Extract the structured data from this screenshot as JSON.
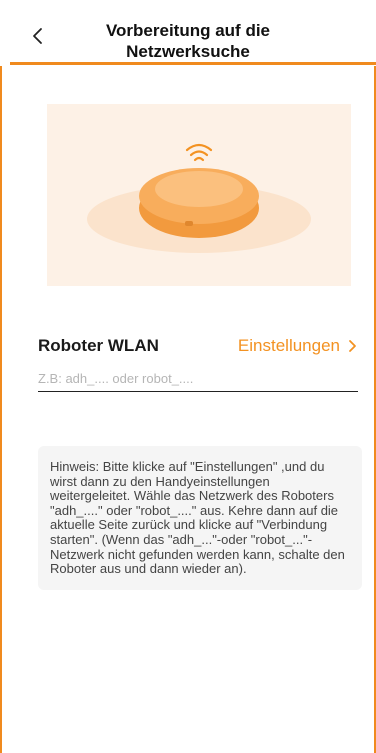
{
  "header": {
    "title_line1": "Vorbereitung auf die",
    "title_line2": "Netzwerksuche",
    "back_icon": "chevron-left-icon"
  },
  "illustration": {
    "description": "robot-vacuum-with-wifi",
    "colors": {
      "background": "#fdf1e6",
      "robot": "#f6a24a",
      "wifi": "#f39222"
    }
  },
  "wifi_section": {
    "label": "Roboter WLAN",
    "settings_link": "Einstellungen",
    "settings_icon": "chevron-right-icon",
    "input_placeholder": "Z.B: adh_.... oder robot_....",
    "input_value": ""
  },
  "hint": {
    "text": "Hinweis: Bitte klicke auf \"Einstellungen\" ,und du wirst dann zu den Handyeinstellungen weitergeleitet. Wähle das Netzwerk des Roboters \"adh_....\" oder \"robot_....\" aus. Kehre dann auf die aktuelle Seite zurück und klicke auf \"Verbindung starten\". (Wenn das \"adh_...\"-oder \"robot_...\"-Netzwerk nicht gefunden werden kann, schalte den Roboter aus und dann wieder an)."
  },
  "colors": {
    "accent": "#f08a1e",
    "link": "#f39222",
    "hint_bg": "#f5f5f5"
  }
}
